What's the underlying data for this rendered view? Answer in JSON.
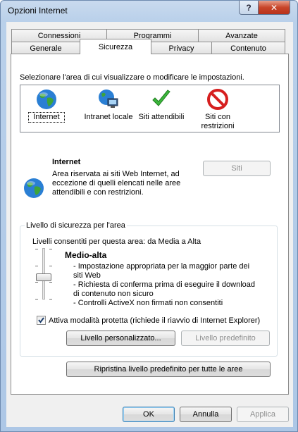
{
  "window": {
    "title": "Opzioni Internet",
    "help_glyph": "?",
    "close_glyph": "✕"
  },
  "tabs": {
    "row1": [
      "Connessioni",
      "Programmi",
      "Avanzate"
    ],
    "row2": [
      "Generale",
      "Sicurezza",
      "Privacy",
      "Contenuto"
    ],
    "active": "Sicurezza"
  },
  "security": {
    "zones_prompt": "Selezionare l'area di cui visualizzare o modificare le impostazioni.",
    "zones": [
      {
        "label": "Internet",
        "icon": "globe-icon",
        "selected": true
      },
      {
        "label": "Intranet locale",
        "icon": "intranet-globe-icon",
        "selected": false
      },
      {
        "label": "Siti attendibili",
        "icon": "checkmark-icon",
        "selected": false
      },
      {
        "label": "Siti con restrizioni",
        "icon": "restricted-icon",
        "selected": false
      }
    ],
    "zone_detail": {
      "title": "Internet",
      "description": "Area riservata ai siti Web Internet, ad eccezione di quelli elencati nelle aree attendibili e con restrizioni.",
      "sites_button": "Siti"
    },
    "level_group": {
      "legend": "Livello di sicurezza per l'area",
      "allowed": "Livelli consentiti per questa area: da Media a Alta",
      "level_name": "Medio-alta",
      "bullets": [
        "- Impostazione appropriata per la maggior parte dei siti Web",
        "- Richiesta di conferma prima di eseguire il download di contenuto non sicuro",
        "- Controlli ActiveX non firmati non consentiti"
      ],
      "slider_level": 2,
      "slider_levels": 4,
      "protected_mode_label": "Attiva modalità protetta (richiede il riavvio di Internet Explorer)",
      "protected_mode_checked": true,
      "custom_level_button": "Livello personalizzato...",
      "default_level_button": "Livello predefinito"
    },
    "reset_all_button": "Ripristina livello predefinito per tutte le aree"
  },
  "footer": {
    "ok": "OK",
    "cancel": "Annulla",
    "apply": "Applica"
  },
  "colors": {
    "title_bar": "#b9d0ea",
    "close_button": "#c8452a",
    "panel_bg": "#ffffff",
    "dialog_bg": "#f0f0f0"
  }
}
